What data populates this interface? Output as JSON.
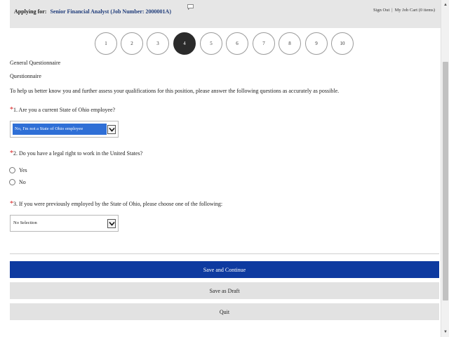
{
  "header": {
    "applying_label": "Applying for:",
    "job_title": "Senior Financial Analyst (Job Number: 2000001A)",
    "sign_out": "Sign Out",
    "separator": "|",
    "job_cart": "My Job Cart (0 items)"
  },
  "steps": [
    {
      "label": "1"
    },
    {
      "label": "2"
    },
    {
      "label": "3"
    },
    {
      "label": "4",
      "active": true
    },
    {
      "label": "5"
    },
    {
      "label": "6"
    },
    {
      "label": "7"
    },
    {
      "label": "8"
    },
    {
      "label": "9"
    },
    {
      "label": "10"
    }
  ],
  "content": {
    "section_title": "General Questionnaire",
    "questionnaire_heading": "Questionnaire",
    "intro": "To help us better know you and further assess your qualifications for this position, please answer the following questions as accurately as possible."
  },
  "questions": {
    "required_mark": "*",
    "q1": {
      "text": "1. Are you a current State of Ohio employee?",
      "selected": "No, I'm not a State of Ohio employee"
    },
    "q2": {
      "text": "2. Do you have a legal right to work in the United States?",
      "option_yes": "Yes",
      "option_no": "No"
    },
    "q3": {
      "text": "3. If you were previously employed by the State of Ohio, please choose one of the following:",
      "selected": "No Selection"
    }
  },
  "buttons": {
    "save_continue": "Save and Continue",
    "save_draft": "Save as Draft",
    "quit": "Quit"
  },
  "colors": {
    "primary": "#0e3aa0",
    "required": "#d81e1e",
    "active_step": "#2b2b2b"
  }
}
